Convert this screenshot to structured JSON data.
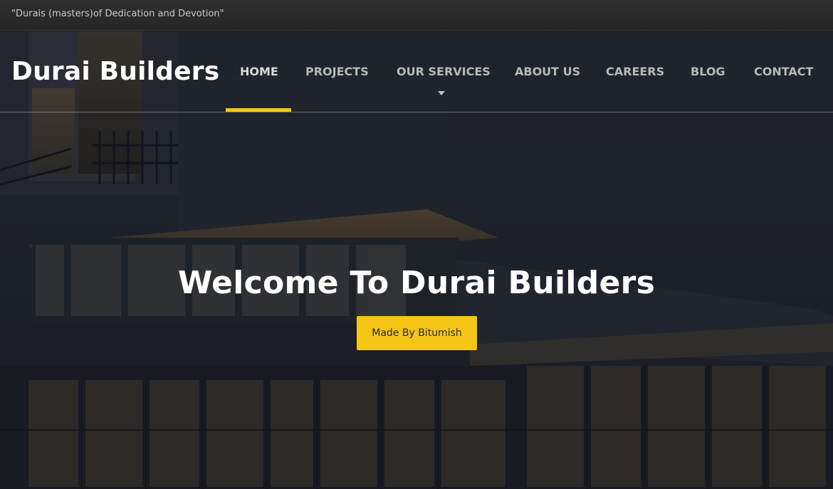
{
  "topbar": {
    "tagline": "\"Durais (masters)of Dedication and Devotion\""
  },
  "header": {
    "brand": "Durai Builders",
    "nav": [
      {
        "label": "HOME",
        "active": true
      },
      {
        "label": "PROJECTS",
        "active": false
      },
      {
        "label": "OUR SERVICES",
        "active": false,
        "has_dropdown": true
      },
      {
        "label": "ABOUT US",
        "active": false
      },
      {
        "label": "CAREERS",
        "active": false
      },
      {
        "label": "BLOG",
        "active": false
      },
      {
        "label": "CONTACT",
        "active": false
      }
    ]
  },
  "hero": {
    "title": "Welcome To Durai Builders",
    "button_label": "Made By Bitumish"
  },
  "colors": {
    "accent": "#f5c518",
    "topbar_bg": "#2b2b2b",
    "nav_text": "#b9b9b9",
    "hero_overlay": "#1c1f26"
  },
  "icons": {
    "dropdown": "caret-down-icon"
  }
}
